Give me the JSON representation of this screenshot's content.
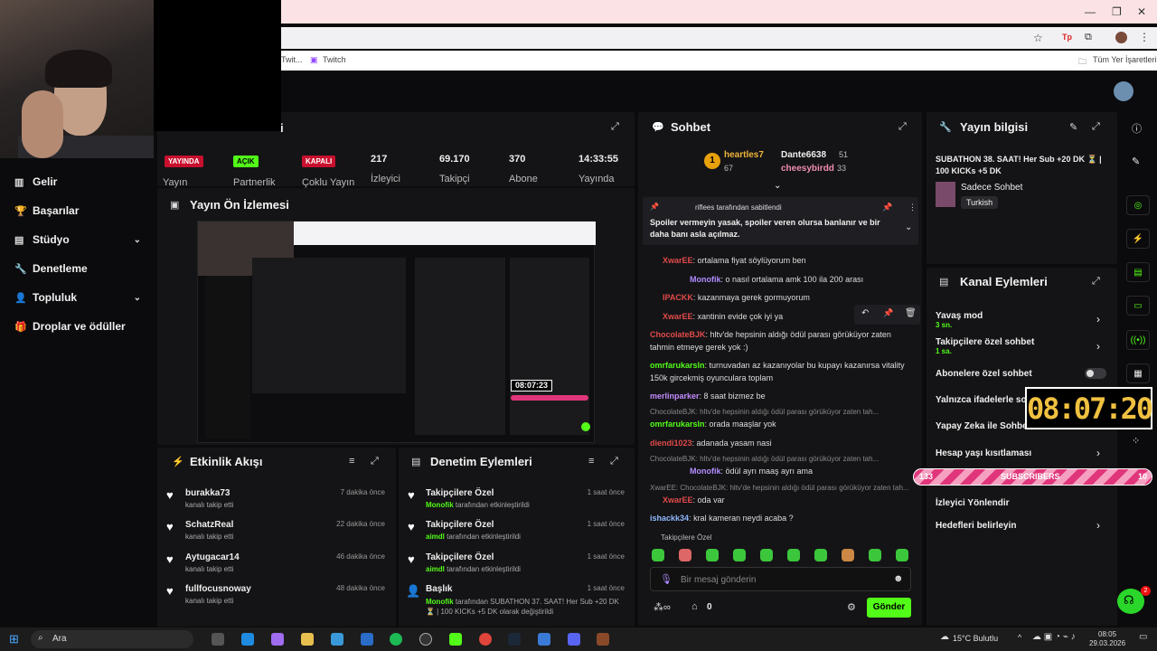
{
  "browser": {
    "bookmarks": [
      "Twit...",
      "Twitch"
    ],
    "all_bookmarks": "Tüm Yer İşaretleri"
  },
  "sidebar": {
    "items": [
      {
        "label": "Gelir",
        "icon": "bar-chart-icon"
      },
      {
        "label": "Başarılar",
        "icon": "trophy-icon"
      },
      {
        "label": "Stüdyo",
        "icon": "studio-icon"
      },
      {
        "label": "Denetleme",
        "icon": "wrench-icon"
      },
      {
        "label": "Topluluk",
        "icon": "user-icon"
      },
      {
        "label": "Droplar ve ödüller",
        "icon": "gift-icon"
      }
    ]
  },
  "stats": {
    "title_fragment": "i",
    "live_badge": "YAYINDA",
    "live_label": "Yayın",
    "partner_badge": "AÇIK",
    "partner_label": "Partnerlik",
    "multi_badge": "KAPALI",
    "multi_label": "Çoklu Yayın",
    "viewers": "217",
    "viewers_label": "İzleyici",
    "followers": "69.170",
    "followers_label": "Takipçi",
    "subs": "370",
    "subs_label": "Abone",
    "uptime": "14:33:55",
    "uptime_label": "Yayında"
  },
  "preview": {
    "title": "Yayın Ön İzlemesi",
    "timer": "08:07:23"
  },
  "activity": {
    "title": "Etkinlik Akışı",
    "items": [
      {
        "name": "burakka73",
        "sub": "kanalı takip etti",
        "time": "7 dakika önce"
      },
      {
        "name": "SchatzReal",
        "sub": "kanalı takip etti",
        "time": "22 dakika önce"
      },
      {
        "name": "Aytugacar14",
        "sub": "kanalı takip etti",
        "time": "46 dakika önce"
      },
      {
        "name": "fullfocusnoway",
        "sub": "kanalı takip etti",
        "time": "48 dakika önce"
      }
    ]
  },
  "moderation": {
    "title": "Denetim Eylemleri",
    "items": [
      {
        "name": "Takipçilere Özel",
        "actor": "Monofik",
        "sub": "tarafından etkinleştirildi",
        "time": "1 saat önce"
      },
      {
        "name": "Takipçilere Özel",
        "actor": "aimdl",
        "sub": "tarafından etkinleştirildi",
        "time": "1 saat önce"
      },
      {
        "name": "Takipçilere Özel",
        "actor": "aimdl",
        "sub": "tarafından etkinleştirildi",
        "time": "1 saat önce"
      },
      {
        "name": "Başlık",
        "actor": "Monofik",
        "sub": "tarafından SUBATHON 37. SAAT! Her Sub +20 DK ⏳ | 100 KICKs +5 DK olarak değiştirildi",
        "time": "1 saat önce"
      }
    ]
  },
  "chat": {
    "title": "Sohbet",
    "top1": "heartles7",
    "top1_count": "67",
    "top2": "Dante6638",
    "top2_count": "51",
    "top3": "cheesybirdd",
    "top3_count": "33",
    "pinned_by": "riflees tarafından sabitlendi",
    "pinned_text": "Spoiler vermeyin yasak, spoiler veren olursa banlanır ve bir daha banı asla açılmaz.",
    "messages": [
      {
        "user": "XwarEE",
        "color": "#e24a4a",
        "text": "ortalama fiyat söylüyorum ben"
      },
      {
        "user": "Monofik",
        "color": "#b18cff",
        "text": "o nasıl ortalama amk 100 ila 200 arası"
      },
      {
        "user": "IPACKK",
        "color": "#e24a4a",
        "text": "kazanmaya gerek gormuyorum"
      },
      {
        "user": "XwarEE",
        "color": "#e24a4a",
        "text": "xantinin evide çok iyi ya"
      },
      {
        "user": "ChocolateBJK",
        "color": "#e24a4a",
        "text": "hltv'de hepsinin aldığı ödül parası görüküyor zaten tahmin etmeye gerek yok :)"
      },
      {
        "user": "omrfarukarsln",
        "color": "#53fc18",
        "text": "turnuvadan az kazanıyolar bu kupayı kazanırsa vitality 150k gircekmiş oyunculara toplam"
      },
      {
        "user": "merlinparker",
        "color": "#c38cff",
        "text": "8 saat bizmez be"
      },
      {
        "user": "omrfarukarsln",
        "color": "#53fc18",
        "text": "orada maaşlar yok"
      },
      {
        "user": "diendi1023",
        "color": "#e24a4a",
        "text": "adanada yasam nasi"
      },
      {
        "user": "Monofik",
        "color": "#b18cff",
        "text": "ödül ayrı maaş ayrı ama"
      },
      {
        "user": "XwarEE",
        "color": "#e24a4a",
        "text": "oda var"
      },
      {
        "user": "ishackk34",
        "color": "#8fb8ff",
        "text": "kral kameran neydi acaba ?"
      }
    ],
    "reply1": "ChocolateBJK: hltv'de hepsinin aldığı ödül parası görüküyor zaten tah...",
    "reply2": "ChocolateBJK: hltv'de hepsinin aldığı ödül parası görüküyor zaten tah...",
    "reply3": "XwarEE: ChocolateBJK: hltv'de hepsinin aldığı ödül parası görüküyor zaten tah...",
    "followers_only": "Takipçilere Özel",
    "input_placeholder": "Bir mesaj gönderin",
    "points": "0",
    "send": "Gönder"
  },
  "stream_info": {
    "title": "Yayın bilgisi",
    "stream_title": "SUBATHON 38. SAAT! Her Sub +20 DK ⏳ | 100 KICKs +5 DK",
    "category": "Sadece Sohbet",
    "language": "Turkish"
  },
  "channel_actions": {
    "title": "Kanal Eylemleri",
    "items": [
      {
        "label": "Yavaş mod",
        "sub": "3 sn."
      },
      {
        "label": "Takipçilere özel sohbet",
        "sub": "1 sa."
      },
      {
        "label": "Abonelere özel sohbet",
        "sub": ""
      },
      {
        "label": "Yalnızca ifadelerle sohbet",
        "sub": ""
      },
      {
        "label": "Yapay Zeka ile Sohbet",
        "sub": ""
      },
      {
        "label": "Hesap yaşı kısıtlaması",
        "sub": ""
      },
      {
        "label": "İzleyici Yönlendir",
        "sub": ""
      },
      {
        "label": "Hedefleri belirleyin",
        "sub": ""
      }
    ]
  },
  "overlays": {
    "big_timer": "08:07:20",
    "sub_left": "133",
    "sub_label": "SUBSCRIBERS",
    "sub_right": "10",
    "notif_count": "2"
  },
  "taskbar": {
    "search": "Ara",
    "weather": "15°C Bulutlu",
    "time": "08:05",
    "date": "29.03.2026"
  }
}
